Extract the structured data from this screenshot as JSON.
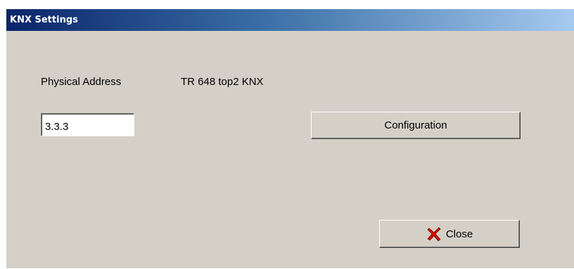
{
  "window": {
    "title": "KNX Settings"
  },
  "form": {
    "physical_address_label": "Physical Address",
    "device_name": "TR 648 top2 KNX",
    "physical_address_value": "3.3.3"
  },
  "buttons": {
    "configuration_label": "Configuration",
    "close_label": "Close",
    "close_icon": "close-x-icon"
  },
  "colors": {
    "title_bar_start": "#0a246a",
    "title_bar_end": "#a6caf0",
    "window_face": "#d4d0c8",
    "close_icon_red": "#cc1100"
  }
}
